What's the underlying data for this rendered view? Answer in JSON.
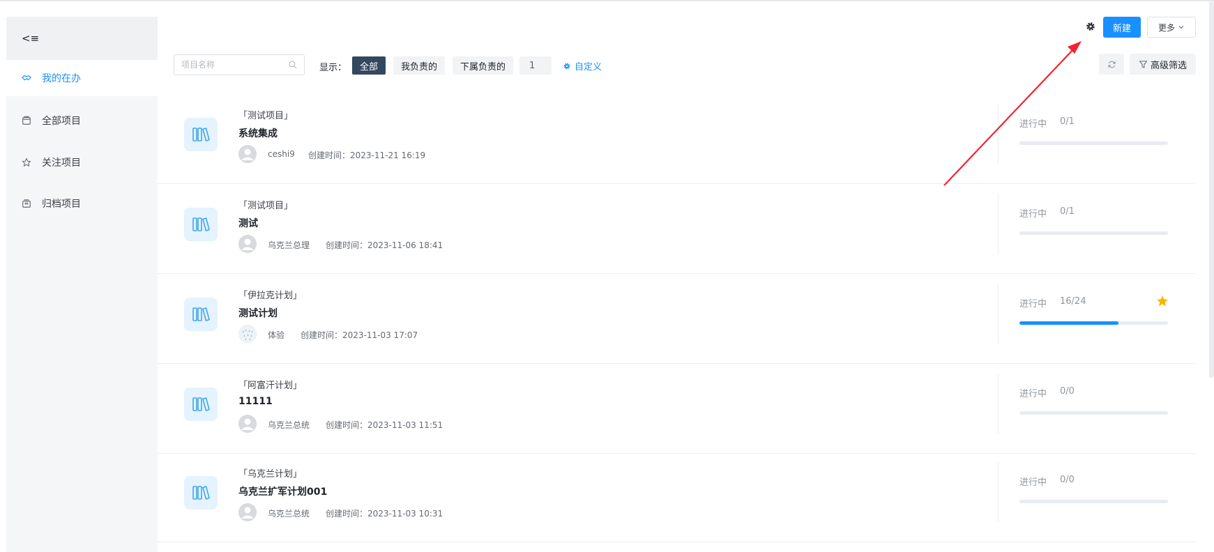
{
  "colors": {
    "accent": "#1890ff",
    "active_chip": "#33475f",
    "star": "#f7b500",
    "arrow": "#f5222d"
  },
  "sidebar": {
    "collapse_label": "<≡",
    "items": [
      {
        "label": "我的在办",
        "icon": "handshake-icon",
        "active": true
      },
      {
        "label": "全部项目",
        "icon": "folder-icon",
        "active": false
      },
      {
        "label": "关注项目",
        "icon": "star-icon",
        "active": false
      },
      {
        "label": "归档项目",
        "icon": "archive-icon",
        "active": false
      }
    ]
  },
  "header": {
    "new_label": "新建",
    "more_label": "更多",
    "settings_icon": "gear-icon"
  },
  "toolbar": {
    "search_placeholder": "项目名称",
    "show_label": "显示：",
    "chips": [
      "全部",
      "我负责的",
      "下属负责的"
    ],
    "page_value": "1",
    "customize_label": "自定义",
    "advanced_filter_label": "高级筛选"
  },
  "projects": [
    {
      "category": "「测试项目」",
      "name": "系统集成",
      "owner": "ceshi9",
      "created": "创建时间：2023-11-21 16:19",
      "status": "进行中",
      "progress_text": "0/1",
      "progress": 0,
      "starred": false
    },
    {
      "category": "「测试项目」",
      "name": "测试",
      "owner": "乌克兰总理",
      "created": "创建时间：2023-11-06 18:41",
      "status": "进行中",
      "progress_text": "0/1",
      "progress": 0,
      "starred": false
    },
    {
      "category": "「伊拉克计划」",
      "name": "测试计划",
      "owner": "体验",
      "created": "创建时间：2023-11-03 17:07",
      "status": "进行中",
      "progress_text": "16/24",
      "progress": 0.667,
      "starred": true
    },
    {
      "category": "「阿富汗计划」",
      "name": "11111",
      "owner": "乌克兰总统",
      "created": "创建时间：2023-11-03 11:51",
      "status": "进行中",
      "progress_text": "0/0",
      "progress": 0,
      "starred": false
    },
    {
      "category": "「乌克兰计划」",
      "name": "乌克兰扩军计划001",
      "owner": "乌克兰总统",
      "created": "创建时间：2023-11-03 10:31",
      "status": "进行中",
      "progress_text": "0/0",
      "progress": 0,
      "starred": false
    }
  ]
}
